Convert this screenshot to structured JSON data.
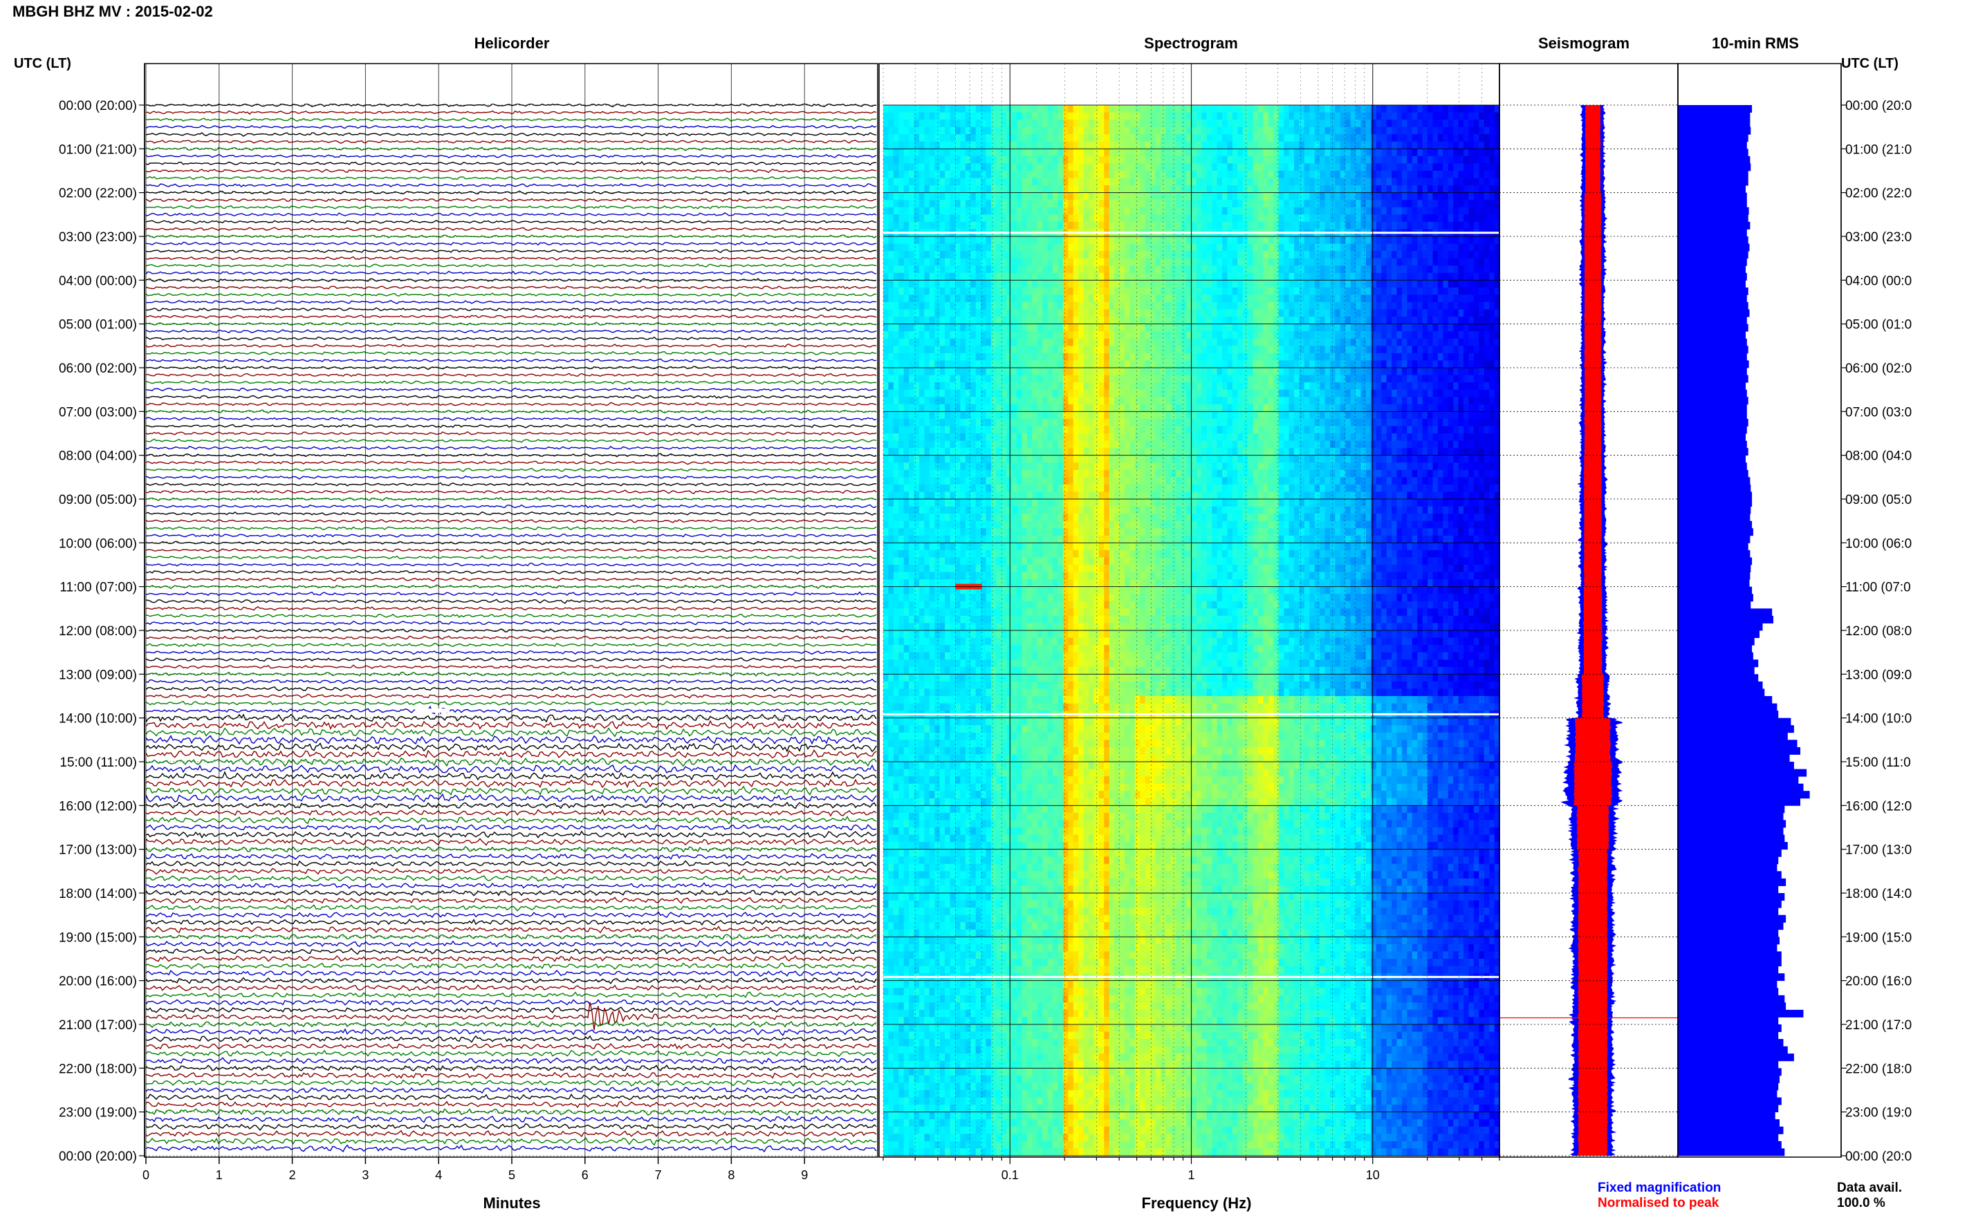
{
  "header": {
    "station_title": "MBGH BHZ MV : 2015-02-02",
    "utc_lt_left": "UTC (LT)",
    "utc_lt_right": "UTC (LT)"
  },
  "panels": {
    "helicorder": "Helicorder",
    "spectrogram": "Spectrogram",
    "seismogram": "Seismogram",
    "rms": "10-min RMS"
  },
  "row_labels": [
    "00:00 (20:00)",
    "01:00 (21:00)",
    "02:00 (22:00)",
    "03:00 (23:00)",
    "04:00 (00:00)",
    "05:00 (01:00)",
    "06:00 (02:00)",
    "07:00 (03:00)",
    "08:00 (04:00)",
    "09:00 (05:00)",
    "10:00 (06:00)",
    "11:00 (07:00)",
    "12:00 (08:00)",
    "13:00 (09:00)",
    "14:00 (10:00)",
    "15:00 (11:00)",
    "16:00 (12:00)",
    "17:00 (13:00)",
    "18:00 (14:00)",
    "19:00 (15:00)",
    "20:00 (16:00)",
    "21:00 (17:00)",
    "22:00 (18:00)",
    "23:00 (19:00)",
    "00:00 (20:00)"
  ],
  "right_row_labels": [
    "00:00 (20:0",
    "01:00 (21:0",
    "02:00 (22:0",
    "03:00 (23:0",
    "04:00 (00:0",
    "05:00 (01:0",
    "06:00 (02:0",
    "07:00 (03:0",
    "08:00 (04:0",
    "09:00 (05:0",
    "10:00 (06:0",
    "11:00 (07:0",
    "12:00 (08:0",
    "13:00 (09:0",
    "14:00 (10:0",
    "15:00 (11:0",
    "16:00 (12:0",
    "17:00 (13:0",
    "18:00 (14:0",
    "19:00 (15:0",
    "20:00 (16:0",
    "21:00 (17:0",
    "22:00 (18:0",
    "23:00 (19:0",
    "00:00 (20:0"
  ],
  "footer": {
    "minutes_label": "Minutes",
    "frequency_label": "Frequency (Hz)",
    "legend_fixed": "Fixed magnification",
    "legend_normalised": "Normalised to peak",
    "data_avail_label": "Data avail.",
    "data_avail_value": "100.0 %"
  },
  "colors": {
    "helicorder_traces": [
      "#000000",
      "#8b0000",
      "#008000",
      "#0000c8"
    ],
    "seismogram_fixed": "#0000ff",
    "seismogram_normalised": "#ff0000",
    "rms_bar": "#0000ff",
    "legend_fixed": "#0000ff",
    "legend_normalised": "#ff0000"
  },
  "chart_data": [
    {
      "type": "line",
      "panel": "helicorder",
      "xlabel": "Minutes",
      "x_ticks": [
        "0",
        "1",
        "2",
        "3",
        "4",
        "5",
        "6",
        "7",
        "8",
        "9"
      ],
      "xlim": [
        0,
        10
      ],
      "rows_per_hour": 6,
      "minutes_per_row": 10,
      "trace_amplitude_by_hour": [
        1.0,
        1.0,
        1.0,
        1.0,
        1.0,
        1.0,
        1.0,
        1.0,
        1.0,
        1.0,
        1.0,
        1.1,
        1.1,
        1.3,
        2.6,
        2.6,
        2.0,
        1.8,
        1.8,
        1.8,
        1.8,
        1.9,
        1.9,
        2.0
      ],
      "events": [
        {
          "utc": "20:51",
          "minute": 6.1,
          "relative_amplitude": 8
        },
        {
          "utc": "13:51",
          "minute": 3.9,
          "relative_amplitude": 2
        }
      ]
    },
    {
      "type": "heatmap",
      "panel": "spectrogram",
      "xlabel": "Frequency (Hz)",
      "x_scale": "log",
      "x_ticks": [
        "0.1",
        "1",
        "10"
      ],
      "xlim": [
        0.02,
        50
      ],
      "colormap": "jet",
      "peak_band_hz": [
        0.2,
        0.35
      ],
      "secondary_band_hz": [
        1.5,
        3.0
      ],
      "data_gaps_utc": [
        "02:55",
        "13:55",
        "19:55"
      ]
    },
    {
      "type": "area",
      "panel": "seismogram",
      "series": [
        {
          "name": "Fixed magnification",
          "amplitude_by_hour": [
            0.25,
            0.25,
            0.27,
            0.27,
            0.26,
            0.26,
            0.26,
            0.27,
            0.28,
            0.28,
            0.28,
            0.3,
            0.3,
            0.35,
            0.55,
            0.6,
            0.5,
            0.45,
            0.45,
            0.45,
            0.45,
            0.45,
            0.45,
            0.45
          ]
        },
        {
          "name": "Normalised to peak",
          "amplitude_by_hour": [
            0.18,
            0.18,
            0.2,
            0.2,
            0.2,
            0.2,
            0.2,
            0.2,
            0.21,
            0.21,
            0.21,
            0.22,
            0.22,
            0.26,
            0.42,
            0.45,
            0.38,
            0.35,
            0.35,
            0.35,
            0.35,
            0.35,
            0.35,
            0.35
          ]
        }
      ]
    },
    {
      "type": "bar",
      "panel": "10-min RMS",
      "orientation": "horizontal",
      "bins_per_hour": 6,
      "values": [
        118,
        115,
        115,
        116,
        112,
        110,
        112,
        115,
        116,
        112,
        112,
        108,
        110,
        110,
        113,
        112,
        115,
        110,
        112,
        114,
        112,
        110,
        108,
        110,
        108,
        112,
        110,
        112,
        114,
        110,
        112,
        108,
        110,
        112,
        110,
        113,
        110,
        112,
        108,
        110,
        112,
        110,
        110,
        112,
        110,
        108,
        110,
        112,
        108,
        110,
        112,
        115,
        116,
        118,
        118,
        116,
        115,
        118,
        120,
        115,
        112,
        115,
        118,
        116,
        115,
        114,
        118,
        120,
        116,
        150,
        152,
        135,
        130,
        122,
        118,
        120,
        128,
        122,
        128,
        135,
        138,
        150,
        158,
        160,
        180,
        185,
        175,
        190,
        195,
        178,
        185,
        205,
        192,
        200,
        210,
        195,
        170,
        168,
        172,
        168,
        170,
        175,
        165,
        160,
        158,
        165,
        172,
        160,
        170,
        165,
        160,
        172,
        168,
        160,
        162,
        158,
        165,
        165,
        160,
        170,
        158,
        160,
        170,
        172,
        200,
        160,
        165,
        160,
        168,
        175,
        185,
        160,
        165,
        162,
        160,
        158,
        165,
        160,
        155,
        162,
        168,
        160,
        165,
        170
      ]
    }
  ]
}
